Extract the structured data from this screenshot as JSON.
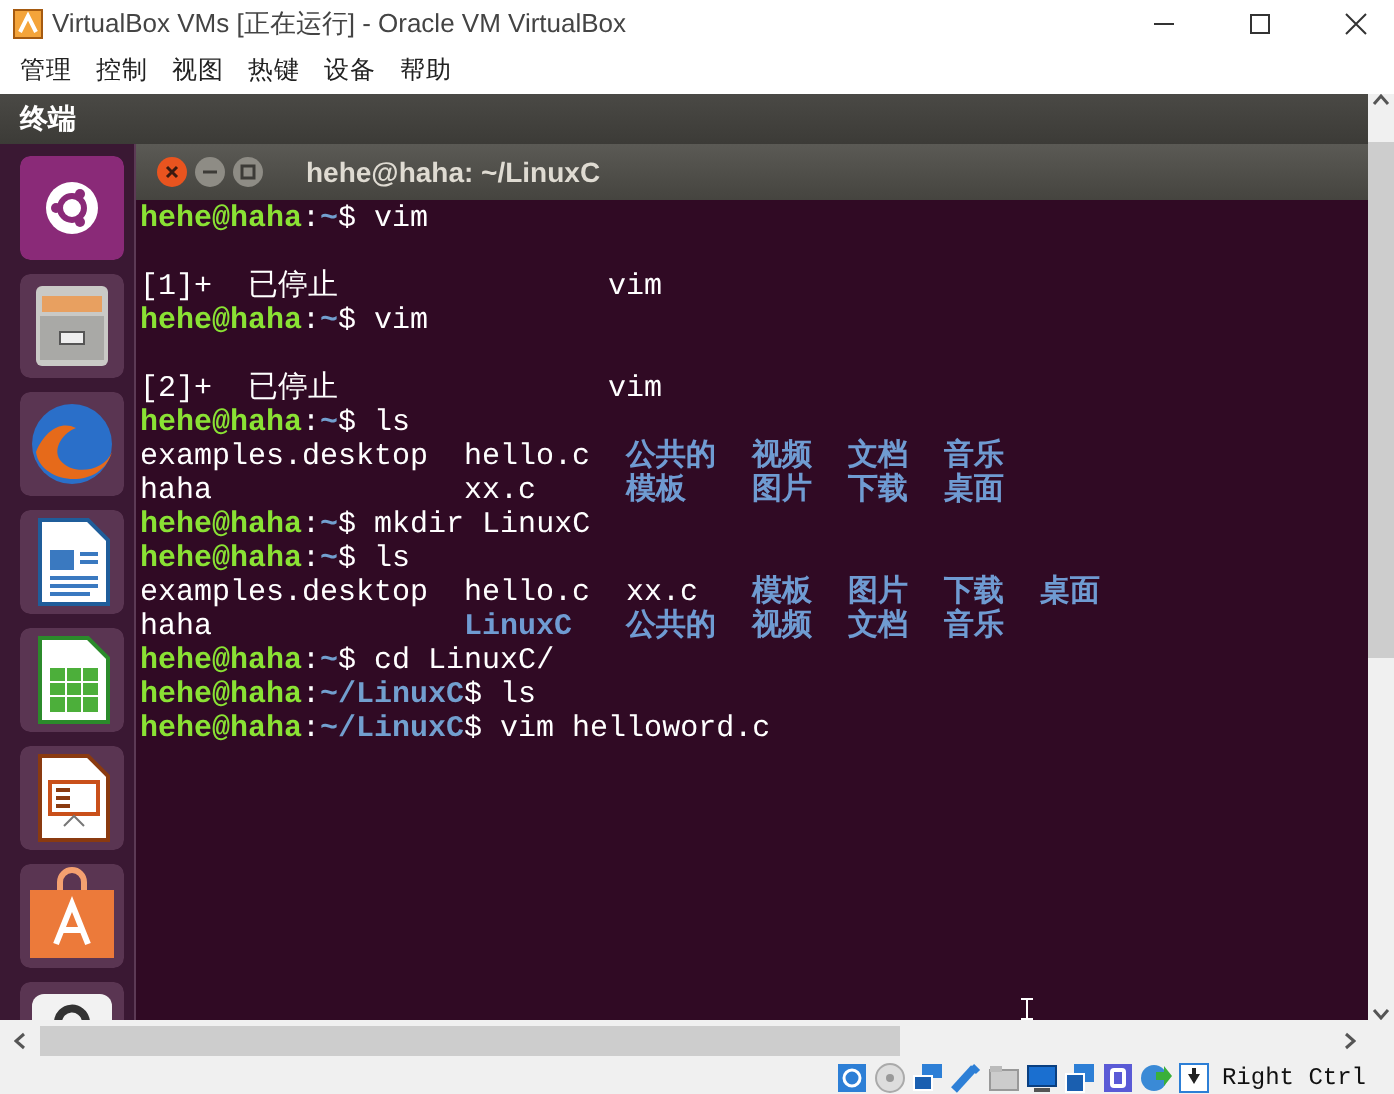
{
  "window": {
    "title": "VirtualBox VMs [正在运行] - Oracle VM VirtualBox"
  },
  "menu": [
    "管理",
    "控制",
    "视图",
    "热键",
    "设备",
    "帮助"
  ],
  "top_panel": {
    "title": "终端"
  },
  "terminal": {
    "title": "hehe@haha: ~/LinuxC",
    "lines": [
      {
        "kind": "prompt",
        "user": "hehe@haha",
        "colon": ":",
        "path": "~",
        "command": "$ vim"
      },
      {
        "kind": "blank"
      },
      {
        "kind": "output",
        "text": "[1]+  已停止               vim"
      },
      {
        "kind": "prompt",
        "user": "hehe@haha",
        "colon": ":",
        "path": "~",
        "command": "$ vim"
      },
      {
        "kind": "blank"
      },
      {
        "kind": "output",
        "text": "[2]+  已停止               vim"
      },
      {
        "kind": "prompt",
        "user": "hehe@haha",
        "colon": ":",
        "path": "~",
        "command": "$ ls"
      },
      {
        "kind": "listing",
        "rows": [
          [
            {
              "text": "examples.desktop",
              "dir": false
            },
            {
              "text": "hello.c",
              "dir": false
            },
            {
              "text": "公共的",
              "dir": true
            },
            {
              "text": "视频",
              "dir": true
            },
            {
              "text": "文档",
              "dir": true
            },
            {
              "text": "音乐",
              "dir": true
            }
          ],
          [
            {
              "text": "haha",
              "dir": false
            },
            {
              "text": "xx.c",
              "dir": false
            },
            {
              "text": "模板",
              "dir": true
            },
            {
              "text": "图片",
              "dir": true
            },
            {
              "text": "下载",
              "dir": true
            },
            {
              "text": "桌面",
              "dir": true
            }
          ]
        ]
      },
      {
        "kind": "prompt",
        "user": "hehe@haha",
        "colon": ":",
        "path": "~",
        "command": "$ mkdir LinuxC"
      },
      {
        "kind": "prompt",
        "user": "hehe@haha",
        "colon": ":",
        "path": "~",
        "command": "$ ls"
      },
      {
        "kind": "listing",
        "rows": [
          [
            {
              "text": "examples.desktop",
              "dir": false
            },
            {
              "text": "hello.c",
              "dir": false
            },
            {
              "text": "xx.c",
              "dir": false
            },
            {
              "text": "模板",
              "dir": true
            },
            {
              "text": "图片",
              "dir": true
            },
            {
              "text": "下载",
              "dir": true
            },
            {
              "text": "桌面",
              "dir": true
            }
          ],
          [
            {
              "text": "haha",
              "dir": false
            },
            {
              "text": "LinuxC",
              "dir": true
            },
            {
              "text": "公共的",
              "dir": true
            },
            {
              "text": "视频",
              "dir": true
            },
            {
              "text": "文档",
              "dir": true
            },
            {
              "text": "音乐",
              "dir": true
            }
          ]
        ]
      },
      {
        "kind": "prompt",
        "user": "hehe@haha",
        "colon": ":",
        "path": "~",
        "command": "$ cd LinuxC/"
      },
      {
        "kind": "prompt",
        "user": "hehe@haha",
        "colon": ":",
        "path": "~/LinuxC",
        "command": "$ ls"
      },
      {
        "kind": "prompt",
        "user": "hehe@haha",
        "colon": ":",
        "path": "~/LinuxC",
        "command": "$ vim helloword.c"
      }
    ]
  },
  "status_bar": {
    "host_key": "Right Ctrl"
  }
}
